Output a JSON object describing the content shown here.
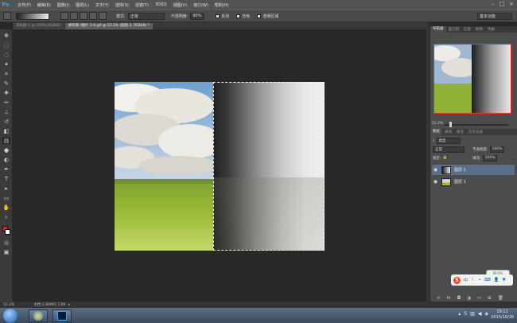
{
  "menu": {
    "logo": "Ps",
    "items": [
      "文件(F)",
      "编辑(E)",
      "图像(I)",
      "图层(L)",
      "文字(Y)",
      "选择(S)",
      "滤镜(T)",
      "3D(D)",
      "视图(V)",
      "窗口(W)",
      "帮助(H)"
    ],
    "win_controls": [
      "–",
      "□",
      "×"
    ]
  },
  "options": {
    "mode_label": "模式:",
    "mode_value": "正常",
    "opacity_label": "不透明度:",
    "opacity_value": "90%",
    "reverse_label": "反向",
    "dither_label": "仿色",
    "transparency_label": "透明区域",
    "workspace": "基本功能"
  },
  "tabs": [
    {
      "label": "未标题-1 @ 100%(RGB/8)"
    },
    {
      "label": "换背景 (图片 1-6.gif @ 52.2% (图层 2, RGB/8) *"
    }
  ],
  "panels": {
    "navigator_tabs": [
      "导航器",
      "直方图",
      "信息",
      "颜色",
      "色板"
    ],
    "zoom": "52.2%",
    "layers_tabs": [
      "图层",
      "通道",
      "路径",
      "历史记录"
    ],
    "kind_label": "类型",
    "blend_mode": "正常",
    "opacity_label": "不透明度:",
    "opacity_value": "100%",
    "lock_label": "锁定:",
    "fill_label": "填充:",
    "fill_value": "100%",
    "layers": [
      {
        "name": "图层 2",
        "selected": true
      },
      {
        "name": "图层 1",
        "selected": false
      }
    ]
  },
  "ime": {
    "letter": "S",
    "mode": "中",
    "cloud": "99.9%"
  },
  "status": {
    "zoom": "52.2%",
    "doc": "文档:2.86M/5.13M"
  },
  "taskbar": {
    "time": "19:11",
    "date": "2015/10/16"
  },
  "colors": {
    "accent": "#31a8ff",
    "selection_border": "#ff2a2a",
    "layer_selected": "#5b6e8a"
  }
}
